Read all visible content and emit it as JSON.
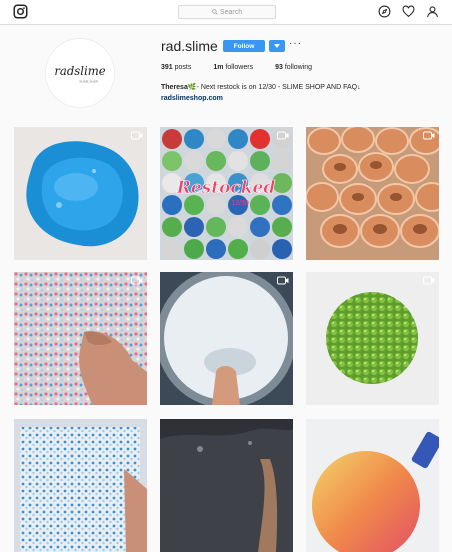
{
  "search": {
    "placeholder": "Search"
  },
  "profile": {
    "username": "rad.slime",
    "avatar_text": "radslime",
    "avatar_subtext": "SLIME SHOP",
    "follow_label": "Follow",
    "more_label": "···",
    "stats": {
      "posts": {
        "value": "391",
        "label": "posts"
      },
      "followers": {
        "value": "1m",
        "label": "followers"
      },
      "following": {
        "value": "93",
        "label": "following"
      }
    },
    "bio_name": "Theresa",
    "bio_emoji": "🌿",
    "bio_text": "- Next restock is on 12/30 - SLIME SHOP AND FAQ↓",
    "link": "radslimeshop.com"
  },
  "posts": [
    {
      "name": "post-blue-slime",
      "video": true
    },
    {
      "name": "post-restocked-jars",
      "overlay_text": "Restocked",
      "overlay_sub": "12/30",
      "video": true
    },
    {
      "name": "post-caramel-jars",
      "video": true
    },
    {
      "name": "post-confetti-slime",
      "video": true
    },
    {
      "name": "post-white-slime-bowl",
      "video": true
    },
    {
      "name": "post-green-beaded-ball",
      "video": true
    },
    {
      "name": "post-blue-beads-tray",
      "video": false
    },
    {
      "name": "post-dark-slime",
      "video": false
    },
    {
      "name": "post-peach-slime-ball",
      "video": false
    }
  ],
  "colors": {
    "accent": "#3897f0",
    "link": "#003569",
    "background": "#fafafa"
  }
}
